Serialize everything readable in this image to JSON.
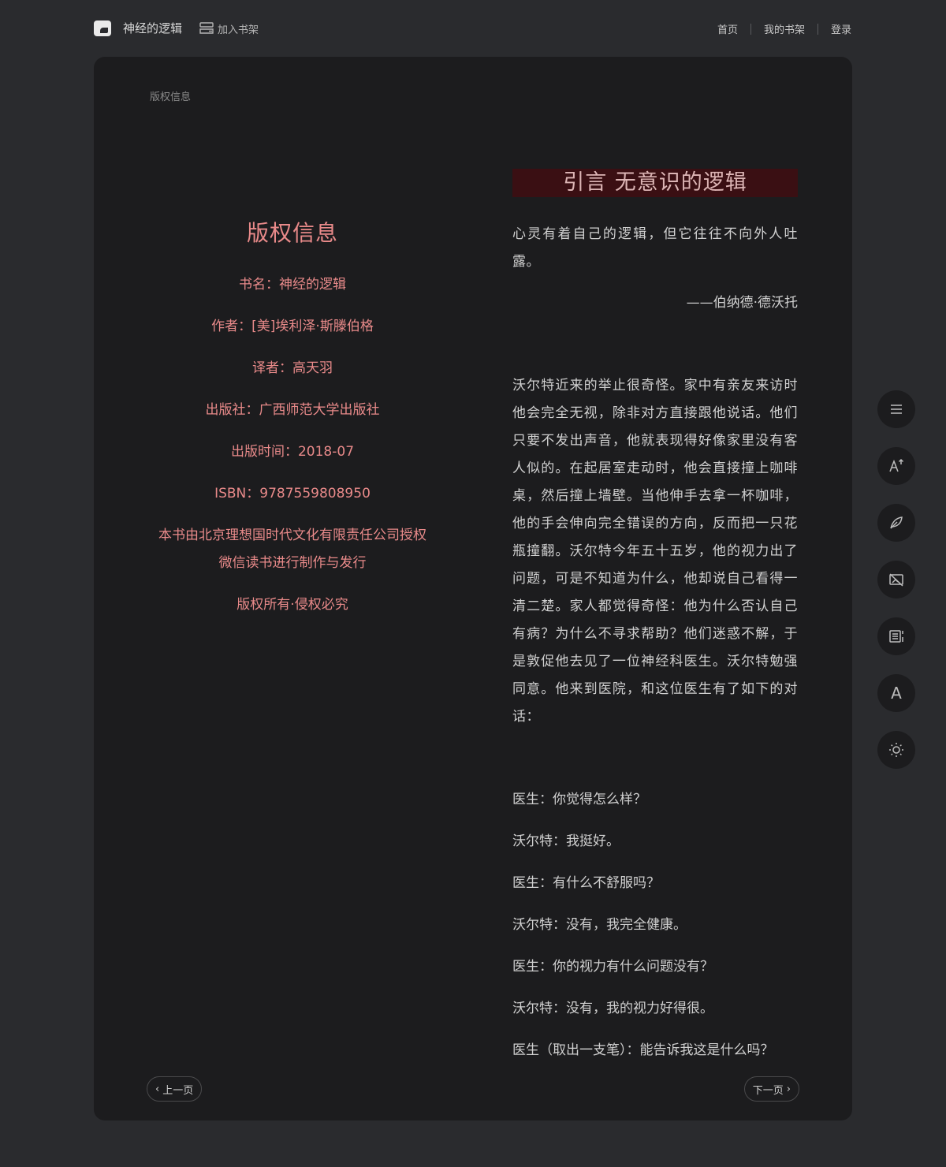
{
  "header": {
    "book_title": "神经的逻辑",
    "add_shelf_label": "加入书架",
    "nav": [
      "首页",
      "我的书架",
      "登录"
    ]
  },
  "reader": {
    "crumb": "版权信息",
    "left_page": {
      "title": "版权信息",
      "book_name": "书名：神经的逻辑",
      "author": "作者：[美]埃利泽·斯滕伯格",
      "translator": "译者：高天羽",
      "publisher": "出版社：广西师范大学出版社",
      "publish_time": "出版时间：2018-07",
      "isbn": "ISBN：9787559808950",
      "license_line1": "本书由北京理想国时代文化有限责任公司授权",
      "license_line2": "微信读书进行制作与发行",
      "rights": "版权所有·侵权必究"
    },
    "right_page": {
      "chapter_heading": "引言 无意识的逻辑",
      "epigraph": "心灵有着自己的逻辑，但它往往不向外人吐露。",
      "attribution": "——伯纳德·德沃托",
      "body": "沃尔特近来的举止很奇怪。家中有亲友来访时他会完全无视，除非对方直接跟他说话。他们只要不发出声音，他就表现得好像家里没有客人似的。在起居室走动时，他会直接撞上咖啡桌，然后撞上墙壁。当他伸手去拿一杯咖啡，他的手会伸向完全错误的方向，反而把一只花瓶撞翻。沃尔特今年五十五岁，他的视力出了问题，可是不知道为什么，他却说自己看得一清二楚。家人都觉得奇怪：他为什么否认自己有病？为什么不寻求帮助？他们迷惑不解，于是敦促他去见了一位神经科医生。沃尔特勉强同意。他来到医院，和这位医生有了如下的对话：",
      "dialog": [
        "医生：你觉得怎么样？",
        "沃尔特：我挺好。",
        "医生：有什么不舒服吗？",
        "沃尔特：没有，我完全健康。",
        "医生：你的视力有什么问题没有？",
        "沃尔特：没有，我的视力好得很。",
        "医生（取出一支笔）：能告诉我这是什么吗？"
      ]
    },
    "pager": {
      "prev": "上一页",
      "next": "下一页"
    }
  },
  "tools": {
    "font_glyph": "A"
  }
}
